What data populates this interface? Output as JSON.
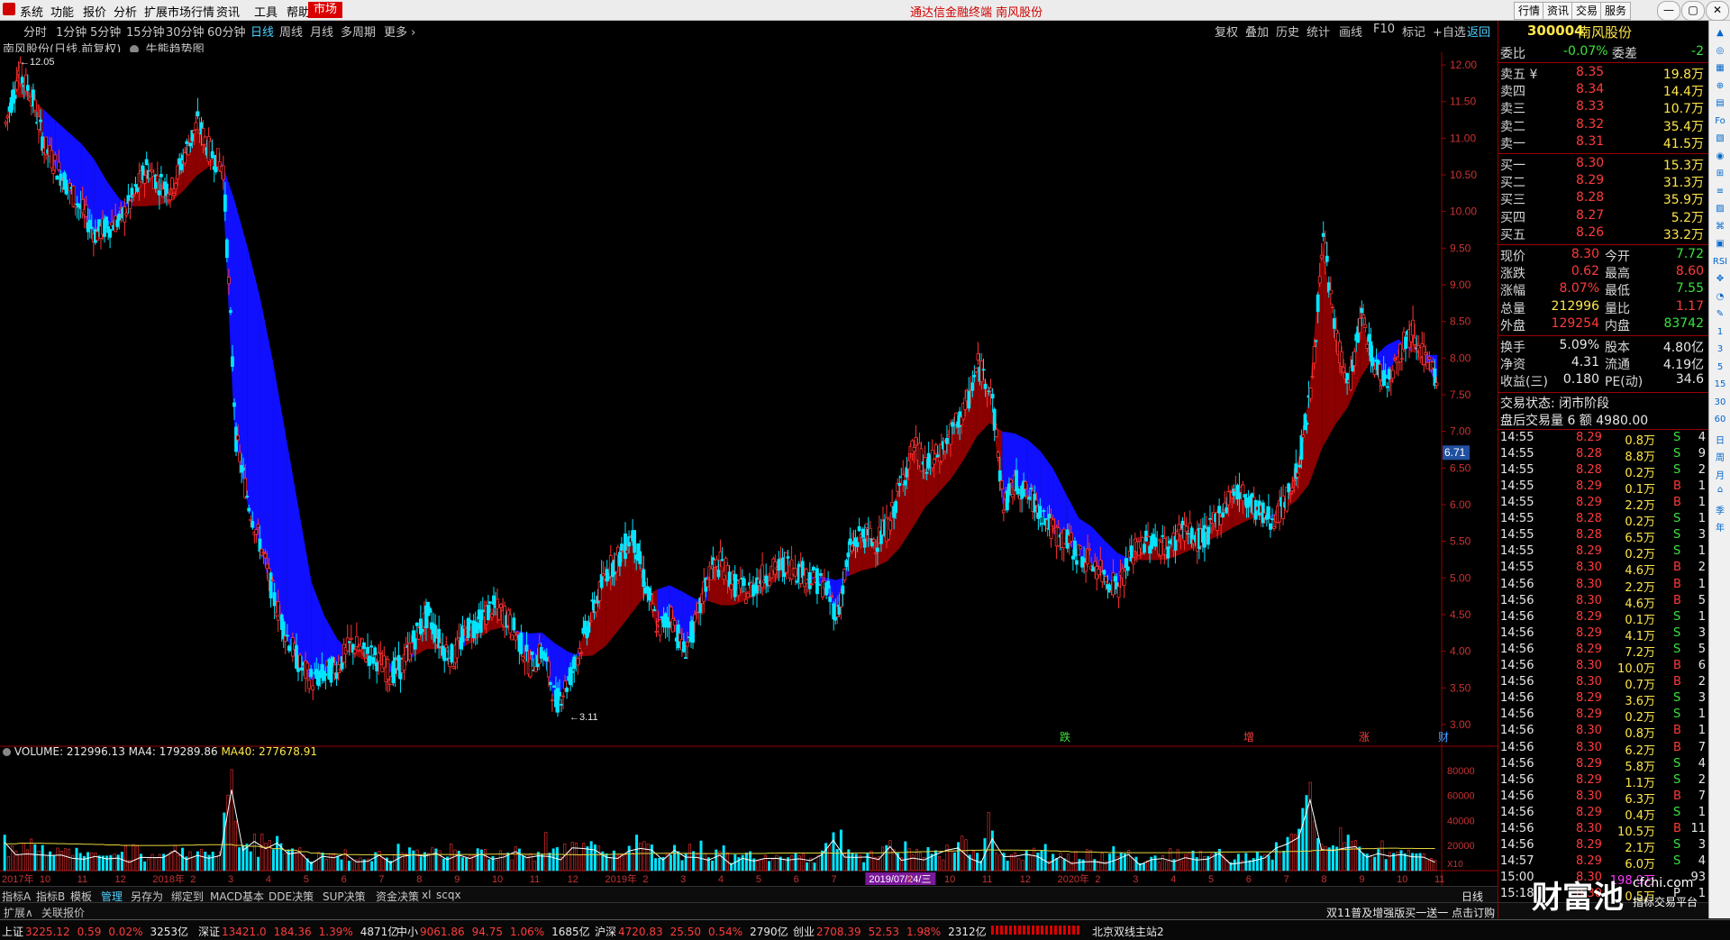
{
  "menubar": {
    "items": [
      "系统",
      "功能",
      "报价",
      "分析",
      "扩展市场行情",
      "资讯",
      "工具",
      "帮助"
    ],
    "active_item": "市场",
    "window_title": "通达信金融终端  南风股份",
    "right_buttons": [
      "行情",
      "资讯",
      "交易",
      "服务"
    ]
  },
  "period_bar": {
    "periods": [
      "分时",
      "1分钟",
      "5分钟",
      "15分钟",
      "30分钟",
      "60分钟",
      "日线",
      "周线",
      "月线",
      "多周期",
      "更多 ›"
    ],
    "selected": "日线",
    "right_tools": [
      "复权",
      "叠加",
      "历史",
      "统计",
      "画线",
      "F10",
      "标记",
      "+自选",
      "返回"
    ]
  },
  "stock": {
    "title": "南风股份(日线,前复权)",
    "indicator": "牛熊趋势图",
    "code": "300004",
    "name": "南风股份"
  },
  "chart_data": {
    "type": "candlestick",
    "price_axis": {
      "ticks": [
        "12.00",
        "11.50",
        "11.00",
        "10.50",
        "10.00",
        "9.50",
        "9.00",
        "8.50",
        "8.00",
        "7.50",
        "7.00",
        "6.50",
        "6.00",
        "5.50",
        "5.00",
        "4.50",
        "4.00",
        "3.50",
        "3.00"
      ],
      "min": 2.95,
      "max": 12.05
    },
    "current_price_label": "6.71",
    "high_marker": "12.05",
    "low_marker": "3.11",
    "event_markers": [
      {
        "text": "跌",
        "color": "#3be33b"
      },
      {
        "text": "增",
        "color": "#ff3b3b"
      },
      {
        "text": "涨",
        "color": "#ff3b3b"
      },
      {
        "text": "财",
        "color": "#40a0ff"
      }
    ],
    "x_axis_labels": [
      "2017年",
      "10",
      "11",
      "12",
      "2018年",
      "2",
      "3",
      "4",
      "5",
      "6",
      "7",
      "8",
      "9",
      "10",
      "11",
      "12",
      "2019年",
      "2",
      "3",
      "4",
      "5",
      "6",
      "7",
      "2019/07/24/三",
      "9",
      "10",
      "11",
      "12",
      "2020年",
      "2",
      "3",
      "4",
      "5",
      "6",
      "7",
      "8",
      "9",
      "10",
      "11"
    ],
    "close_path": [
      11.2,
      11.9,
      11.6,
      10.9,
      10.6,
      10.3,
      10.0,
      9.7,
      9.8,
      9.9,
      10.2,
      10.6,
      10.4,
      10.3,
      10.8,
      11.2,
      10.8,
      10.6,
      6.9,
      6.0,
      5.4,
      4.7,
      4.2,
      3.8,
      3.6,
      3.7,
      3.8,
      4.1,
      4.0,
      3.9,
      3.7,
      3.8,
      4.2,
      4.5,
      4.1,
      3.9,
      4.3,
      4.4,
      4.6,
      4.5,
      4.2,
      3.8,
      4.0,
      3.3,
      3.6,
      4.1,
      4.6,
      5.1,
      5.3,
      5.6,
      4.9,
      4.3,
      4.5,
      4.0,
      4.4,
      5.1,
      5.2,
      4.9,
      4.8,
      5.0,
      5.1,
      5.2,
      5.1,
      5.0,
      4.9,
      4.5,
      5.4,
      5.6,
      5.5,
      5.7,
      6.3,
      6.8,
      6.5,
      6.7,
      7.0,
      7.3,
      7.9,
      7.6,
      6.0,
      6.3,
      6.1,
      5.9,
      5.6,
      5.5,
      5.3,
      5.2,
      5.0,
      4.9,
      5.3,
      5.5,
      5.5,
      5.4,
      5.7,
      5.5,
      5.6,
      5.9,
      6.2,
      6.1,
      5.9,
      5.8,
      6.0,
      6.5,
      7.5,
      9.6,
      8.3,
      7.6,
      8.6,
      7.9,
      7.7,
      8.1,
      8.4,
      8.0,
      7.6
    ],
    "bull_bear_band": [
      {
        "from": 9.9,
        "to": 10.4
      },
      {
        "from": 10.0,
        "to": 10.7
      },
      {
        "from": 10.2,
        "to": 10.9
      },
      {
        "from": 10.2,
        "to": 10.6
      },
      {
        "from": 10.1,
        "to": 10.4
      },
      {
        "from": 10.0,
        "to": 10.2
      }
    ],
    "volume": {
      "legend": {
        "label": "VOLUME: 212996.13",
        "ma4": "MA4: 179289.86",
        "ma40": "MA40: 277678.91"
      },
      "axis_ticks": [
        "80000",
        "60000",
        "40000",
        "20000"
      ],
      "unit": "X10",
      "max": 85000
    }
  },
  "bottom_tabs": [
    "指标A",
    "指标B",
    "模板",
    "管理",
    "另存为",
    "绑定到",
    "MACD基本",
    "DDE决策",
    "SUP决策",
    "资金决策",
    "xl",
    "scqx"
  ],
  "bottom_tabs_active": "管理",
  "period_label": "日线",
  "second_row": [
    "扩展∧",
    "关联报价"
  ],
  "ticker_ad": "双11普及增强版买一送一 点击订购",
  "order_book": {
    "wb_label": "委比",
    "wb_value": "-0.07%",
    "wc_label": "委差",
    "wc_value": "-2",
    "asks": [
      {
        "label": "卖五 ¥",
        "price": "8.35",
        "vol": "19.8万"
      },
      {
        "label": "卖四",
        "price": "8.34",
        "vol": "14.4万"
      },
      {
        "label": "卖三",
        "price": "8.33",
        "vol": "10.7万"
      },
      {
        "label": "卖二",
        "price": "8.32",
        "vol": "35.4万"
      },
      {
        "label": "卖一",
        "price": "8.31",
        "vol": "41.5万"
      }
    ],
    "bids": [
      {
        "label": "买一",
        "price": "8.30",
        "vol": "15.3万"
      },
      {
        "label": "买二",
        "price": "8.29",
        "vol": "31.3万"
      },
      {
        "label": "买三",
        "price": "8.28",
        "vol": "35.9万"
      },
      {
        "label": "买四",
        "price": "8.27",
        "vol": "5.2万"
      },
      {
        "label": "买五",
        "price": "8.26",
        "vol": "33.2万"
      }
    ]
  },
  "quote": [
    {
      "l": "现价",
      "v": "8.30",
      "vc": "red",
      "l2": "今开",
      "v2": "7.72",
      "v2c": "green"
    },
    {
      "l": "涨跌",
      "v": "0.62",
      "vc": "red",
      "l2": "最高",
      "v2": "8.60",
      "v2c": "red"
    },
    {
      "l": "涨幅",
      "v": "8.07%",
      "vc": "red",
      "l2": "最低",
      "v2": "7.55",
      "v2c": "green"
    },
    {
      "l": "总量",
      "v": "212996",
      "vc": "yellow",
      "l2": "量比",
      "v2": "1.17",
      "v2c": "red"
    },
    {
      "l": "外盘",
      "v": "129254",
      "vc": "red",
      "l2": "内盘",
      "v2": "83742",
      "v2c": "green"
    }
  ],
  "fundamentals": [
    {
      "l": "换手",
      "v": "5.09%",
      "l2": "股本",
      "v2": "4.80亿"
    },
    {
      "l": "净资",
      "v": "4.31",
      "l2": "流通",
      "v2": "4.19亿"
    },
    {
      "l": "收益(三)",
      "v": "0.180",
      "l2": "PE(动)",
      "v2": "34.6"
    }
  ],
  "trade_status": "交易状态: 闭市阶段",
  "after_hours": "盘后交易量 6 额 4980.00",
  "ticks": [
    {
      "t": "14:55",
      "p": "8.29",
      "v": "0.8万",
      "s": "S",
      "n": "4"
    },
    {
      "t": "14:55",
      "p": "8.28",
      "v": "8.8万",
      "s": "S",
      "n": "9"
    },
    {
      "t": "14:55",
      "p": "8.28",
      "v": "0.2万",
      "s": "S",
      "n": "2"
    },
    {
      "t": "14:55",
      "p": "8.29",
      "v": "0.1万",
      "s": "B",
      "n": "1"
    },
    {
      "t": "14:55",
      "p": "8.29",
      "v": "2.2万",
      "s": "B",
      "n": "1"
    },
    {
      "t": "14:55",
      "p": "8.28",
      "v": "0.2万",
      "s": "S",
      "n": "1"
    },
    {
      "t": "14:55",
      "p": "8.28",
      "v": "6.5万",
      "s": "S",
      "n": "3"
    },
    {
      "t": "14:55",
      "p": "8.29",
      "v": "0.2万",
      "s": "S",
      "n": "1"
    },
    {
      "t": "14:55",
      "p": "8.30",
      "v": "4.6万",
      "s": "B",
      "n": "2"
    },
    {
      "t": "14:56",
      "p": "8.30",
      "v": "2.2万",
      "s": "B",
      "n": "1"
    },
    {
      "t": "14:56",
      "p": "8.30",
      "v": "4.6万",
      "s": "B",
      "n": "5"
    },
    {
      "t": "14:56",
      "p": "8.29",
      "v": "0.1万",
      "s": "S",
      "n": "1"
    },
    {
      "t": "14:56",
      "p": "8.29",
      "v": "4.1万",
      "s": "S",
      "n": "3"
    },
    {
      "t": "14:56",
      "p": "8.29",
      "v": "7.2万",
      "s": "S",
      "n": "5"
    },
    {
      "t": "14:56",
      "p": "8.30",
      "v": "10.0万",
      "s": "B",
      "n": "6"
    },
    {
      "t": "14:56",
      "p": "8.30",
      "v": "0.7万",
      "s": "B",
      "n": "2"
    },
    {
      "t": "14:56",
      "p": "8.29",
      "v": "3.6万",
      "s": "S",
      "n": "3"
    },
    {
      "t": "14:56",
      "p": "8.29",
      "v": "0.2万",
      "s": "S",
      "n": "1"
    },
    {
      "t": "14:56",
      "p": "8.30",
      "v": "0.8万",
      "s": "B",
      "n": "1"
    },
    {
      "t": "14:56",
      "p": "8.30",
      "v": "6.2万",
      "s": "B",
      "n": "7"
    },
    {
      "t": "14:56",
      "p": "8.29",
      "v": "5.8万",
      "s": "S",
      "n": "4"
    },
    {
      "t": "14:56",
      "p": "8.29",
      "v": "1.1万",
      "s": "S",
      "n": "2"
    },
    {
      "t": "14:56",
      "p": "8.30",
      "v": "6.3万",
      "s": "B",
      "n": "7"
    },
    {
      "t": "14:56",
      "p": "8.29",
      "v": "0.4万",
      "s": "S",
      "n": "1"
    },
    {
      "t": "14:56",
      "p": "8.30",
      "v": "10.5万",
      "s": "B",
      "n": "11"
    },
    {
      "t": "14:56",
      "p": "8.29",
      "v": "2.1万",
      "s": "S",
      "n": "3"
    },
    {
      "t": "14:57",
      "p": "8.29",
      "v": "6.0万",
      "s": "S",
      "n": "4"
    },
    {
      "t": "15:00",
      "p": "8.30",
      "v": "198.9万",
      "s": "",
      "n": "93"
    },
    {
      "t": "15:18",
      "p": "8.30",
      "v": "0.5万",
      "s": "P",
      "n": "1"
    }
  ],
  "status_bar": [
    {
      "label": "上证",
      "vals": [
        "3225.12",
        "0.59",
        "0.02%",
        "3253亿"
      ]
    },
    {
      "label": "深证",
      "vals": [
        "13421.0",
        "184.36",
        "1.39%",
        "4871亿"
      ]
    },
    {
      "label": "中小",
      "vals": [
        "9061.86",
        "94.75",
        "1.06%",
        "1685亿"
      ]
    },
    {
      "label": "沪深",
      "vals": [
        "4720.83",
        "25.50",
        "0.54%",
        "2790亿"
      ]
    },
    {
      "label": "创业",
      "vals": [
        "2708.39",
        "52.53",
        "1.98%",
        "2312亿"
      ]
    }
  ],
  "server": "北京双线主站2",
  "watermark": {
    "brand": "财富池",
    "url": "cfchi.com",
    "sub": "指标交易平台"
  },
  "right_tools": [
    "▲",
    "◎",
    "▦",
    "⊕",
    "▤",
    "Fo",
    "▧",
    "◉",
    "⊞",
    "≡",
    "▨",
    "⌘",
    "▣",
    "RSI",
    "✥",
    "◔",
    "✎",
    "1",
    "3",
    "5",
    "15",
    "30",
    "60",
    "日",
    "周",
    "月",
    "⌂",
    "季",
    "年"
  ]
}
